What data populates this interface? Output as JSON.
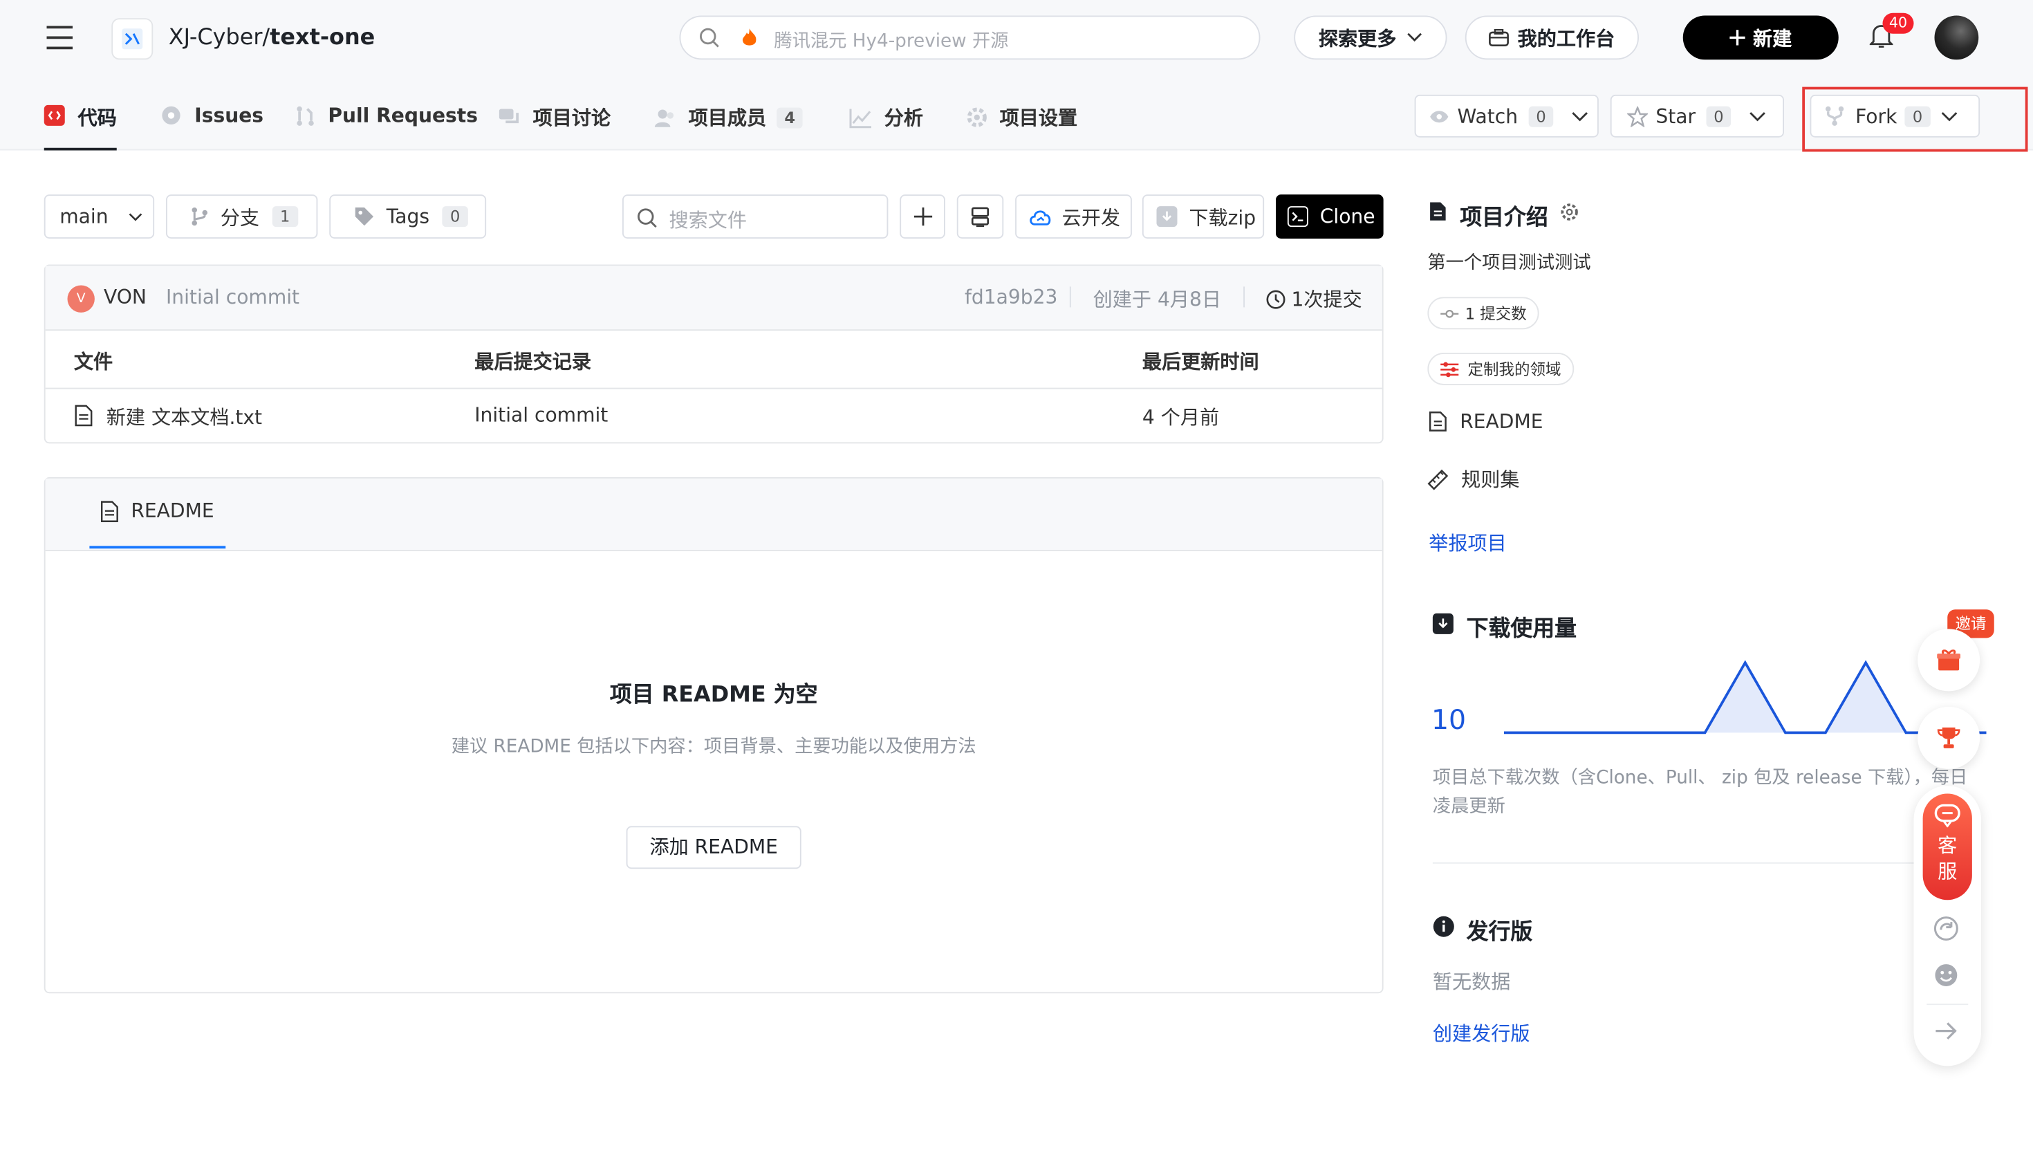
{
  "header": {
    "repo_owner": "XJ-Cyber",
    "repo_sep": "/",
    "repo_name": "text-one",
    "search_placeholder": "腾讯混元 Hy4-preview 开源",
    "explore_label": "探索更多",
    "workbench_label": "我的工作台",
    "new_label": "新建",
    "notification_count": "40"
  },
  "tabs": [
    {
      "label": "代码",
      "active": true
    },
    {
      "label": "Issues"
    },
    {
      "label": "Pull Requests"
    },
    {
      "label": "项目讨论"
    },
    {
      "label": "项目成员",
      "count": "4"
    },
    {
      "label": "分析"
    },
    {
      "label": "项目设置"
    }
  ],
  "repo_actions": {
    "watch_label": "Watch",
    "watch_count": "0",
    "star_label": "Star",
    "star_count": "0",
    "fork_label": "Fork",
    "fork_count": "0",
    "highlight_color": "#e53935"
  },
  "toolbar": {
    "branch": "main",
    "branches_label": "分支",
    "branches_count": "1",
    "tags_label": "Tags",
    "tags_count": "0",
    "search_file_placeholder": "搜索文件",
    "cloud_dev_label": "云开发",
    "download_zip_label": "下载zip",
    "clone_label": "Clone"
  },
  "commit": {
    "avatar_letter": "V",
    "author": "VON",
    "message": "Initial commit",
    "hash": "fd1a9b23",
    "created": "创建于 4月8日",
    "commits_label": "1次提交"
  },
  "file_table": {
    "headers": [
      "文件",
      "最后提交记录",
      "最后更新时间"
    ],
    "rows": [
      {
        "name": "新建 文本文档.txt",
        "commit": "Initial commit",
        "time": "4 个月前"
      }
    ]
  },
  "readme": {
    "tab_label": "README",
    "empty_title": "项目 README 为空",
    "empty_hint": "建议 README 包括以下内容：项目背景、主要功能以及使用方法",
    "add_button": "添加 README"
  },
  "sidebar": {
    "intro_title": "项目介绍",
    "description": "第一个项目测试测试",
    "commits_chip": "1 提交数",
    "domain_chip": "定制我的领域",
    "readme_link": "README",
    "rules_link": "规则集",
    "report_link": "举报项目",
    "downloads_title": "下载使用量",
    "downloads_total": "10",
    "downloads_note": "项目总下载次数（含Clone、Pull、 zip 包及 release 下载），每日凌晨更新",
    "releases_title": "发行版",
    "releases_empty": "暂无数据",
    "create_release": "创建发行版"
  },
  "float_panel": {
    "invite_label": "邀请",
    "service_label": "客服"
  },
  "chart_data": {
    "type": "line",
    "values": [
      0,
      0,
      0,
      0,
      0,
      0,
      5,
      0,
      0,
      5,
      0,
      0,
      0
    ],
    "color": "#1a56db"
  }
}
